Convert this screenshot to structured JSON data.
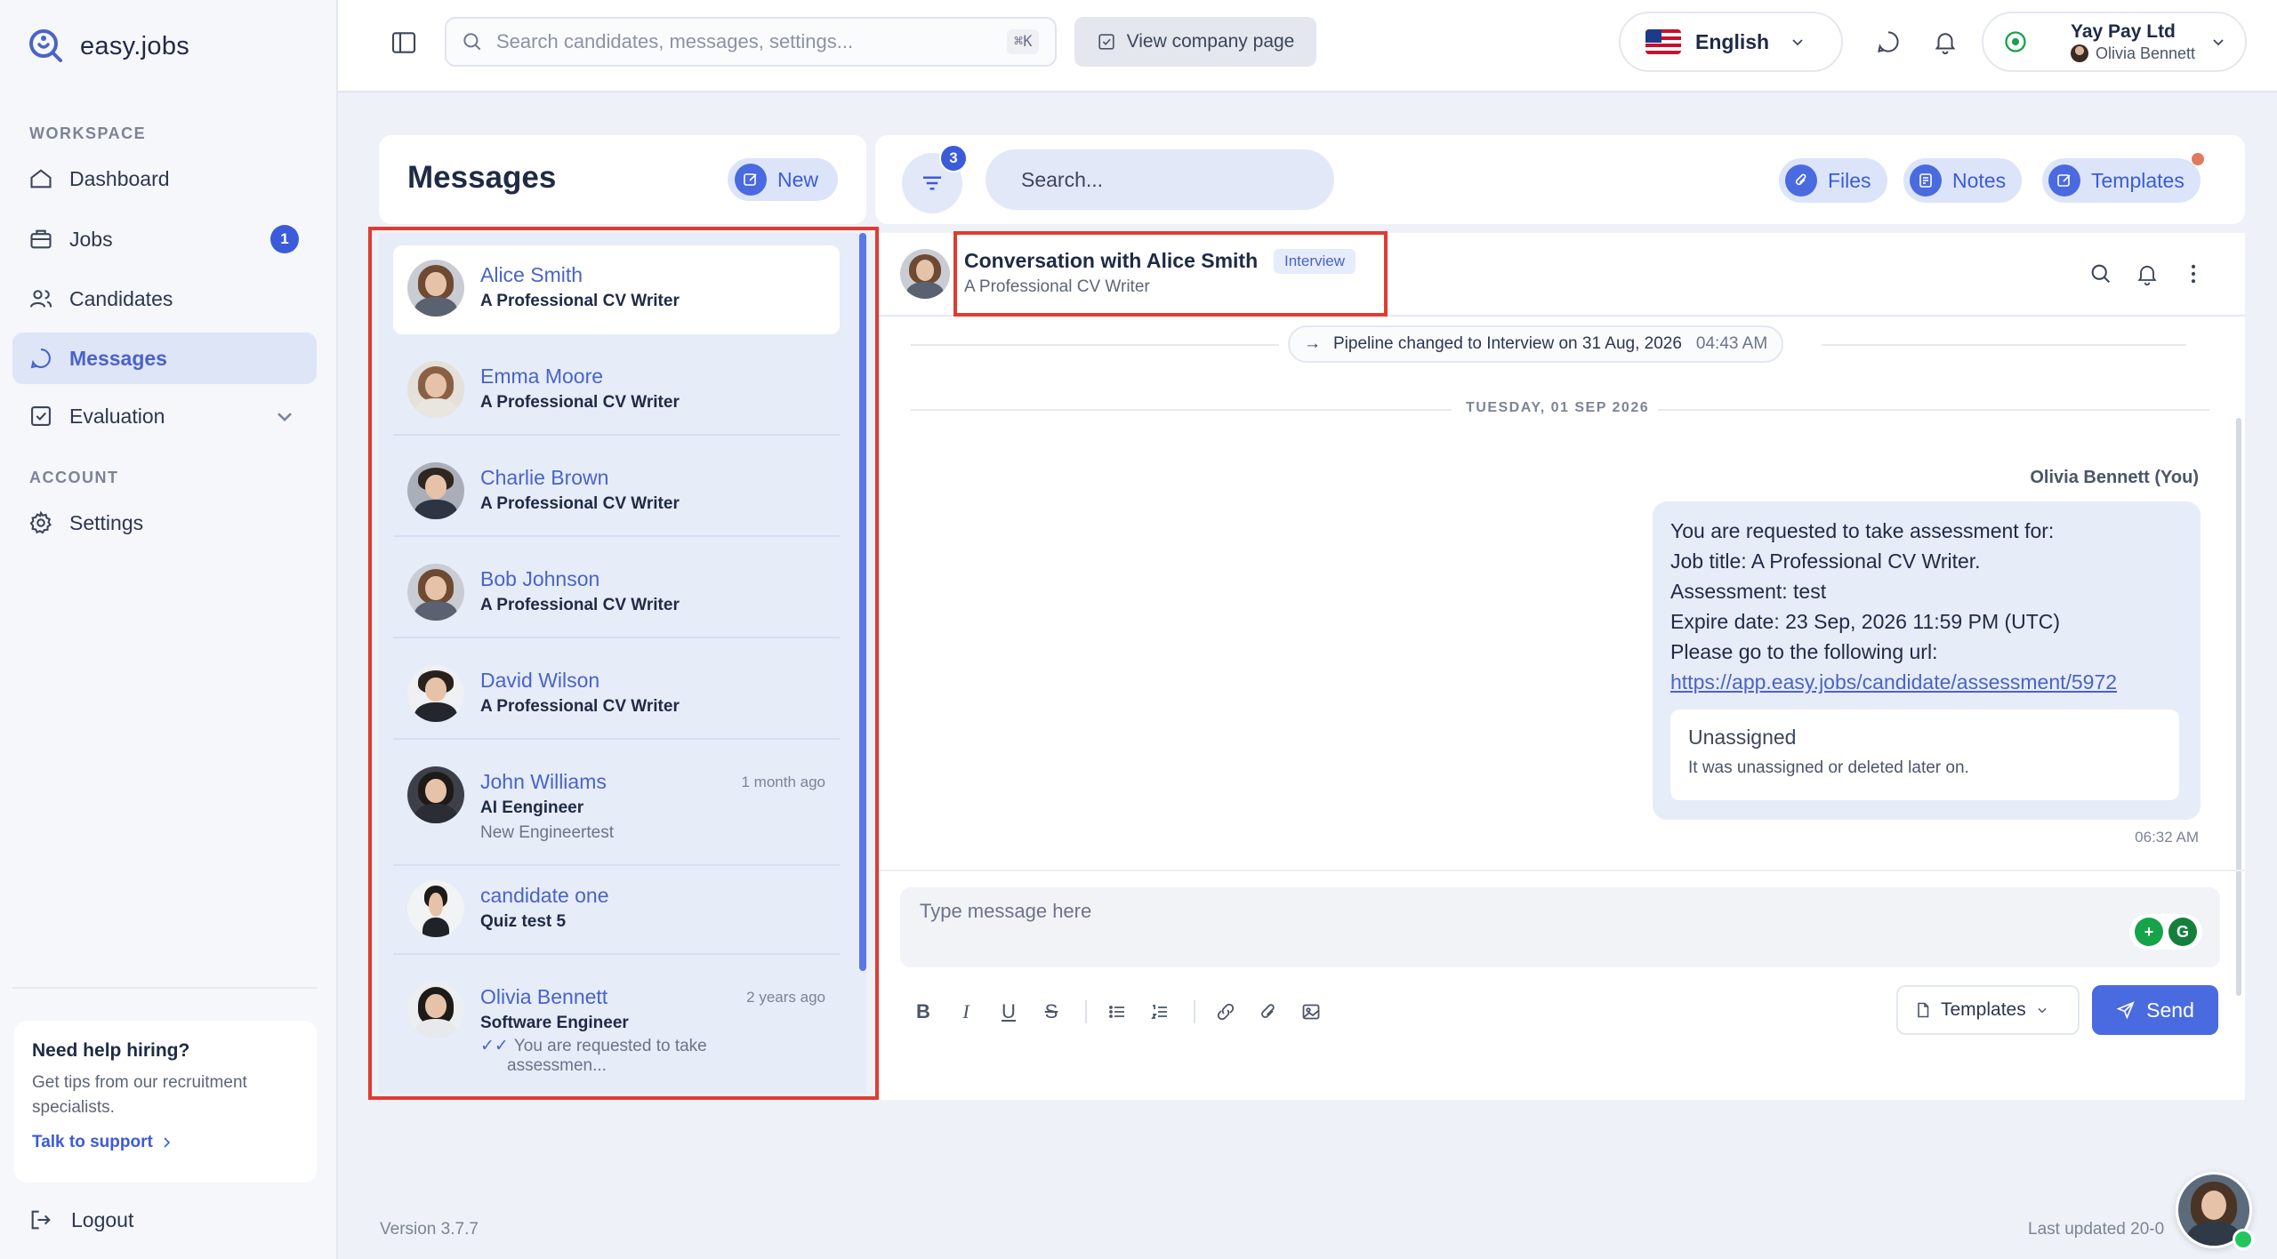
{
  "brand": {
    "name": "easy.jobs"
  },
  "sidebar": {
    "workspace_label": "WORKSPACE",
    "account_label": "ACCOUNT",
    "items": [
      {
        "label": "Dashboard",
        "icon": "home-icon"
      },
      {
        "label": "Jobs",
        "icon": "briefcase-icon",
        "badge": "1"
      },
      {
        "label": "Candidates",
        "icon": "users-icon"
      },
      {
        "label": "Messages",
        "icon": "chat-icon",
        "active": true
      },
      {
        "label": "Evaluation",
        "icon": "checklist-icon"
      }
    ],
    "settings_label": "Settings",
    "help": {
      "title": "Need help hiring?",
      "text": "Get tips from our recruitment specialists.",
      "link": "Talk to support"
    },
    "logout_label": "Logout"
  },
  "topbar": {
    "search_placeholder": "Search candidates, messages, settings...",
    "search_shortcut": "⌘K",
    "company_page_label": "View company page",
    "language": "English",
    "account": {
      "company": "Yay Pay Ltd",
      "user": "Olivia Bennett"
    }
  },
  "messages": {
    "title": "Messages",
    "new_label": "New",
    "filter_count": "3",
    "search_placeholder": "Search...",
    "files_label": "Files",
    "notes_label": "Notes",
    "templates_label": "Templates",
    "list": [
      {
        "name": "Alice Smith",
        "job": "A Professional CV Writer",
        "time": "",
        "sub": ""
      },
      {
        "name": "Emma Moore",
        "job": "A Professional CV Writer",
        "time": "",
        "sub": ""
      },
      {
        "name": "Charlie Brown",
        "job": "A Professional CV Writer",
        "time": "",
        "sub": ""
      },
      {
        "name": "Bob Johnson",
        "job": "A Professional CV Writer",
        "time": "",
        "sub": ""
      },
      {
        "name": "David Wilson",
        "job": "A Professional CV Writer",
        "time": "",
        "sub": ""
      },
      {
        "name": "John Williams",
        "job": "AI Eengineer",
        "time": "1 month ago",
        "sub": "New Engineertest"
      },
      {
        "name": "candidate one",
        "job": "Quiz test 5",
        "time": "",
        "sub": ""
      },
      {
        "name": "Olivia Bennett",
        "job": "Software Engineer",
        "time": "2 years ago",
        "preview_1": "You are requested to take",
        "preview_2": "assessmen..."
      }
    ]
  },
  "conversation": {
    "title": "Conversation with Alice Smith",
    "tag": "Interview",
    "subtitle": "A Professional CV Writer",
    "pipeline_note": "Pipeline changed to Interview on 31 Aug, 2026",
    "pipeline_time": "04:43 AM",
    "day_separator": "TUESDAY, 01 SEP 2026",
    "sender": "Olivia Bennett (You)",
    "message_lines": [
      "You are requested to take assessment for:",
      "Job title: A Professional CV Writer.",
      "Assessment: test",
      "Expire date: 23 Sep, 2026 11:59 PM (UTC)",
      "Please go to the following url:"
    ],
    "message_link": "https://app.easy.jobs/candidate/assessment/5972",
    "unassigned_title": "Unassigned",
    "unassigned_text": "It was unassigned or deleted later on.",
    "message_time": "06:32 AM",
    "composer_placeholder": "Type message here",
    "templates_label": "Templates",
    "send_label": "Send"
  },
  "footer": {
    "version": "Version 3.7.7",
    "last_updated": "Last updated 20-0"
  },
  "colors": {
    "accent": "#4a6ae0",
    "highlight": "#e03b32",
    "active_bg": "#dde5f7"
  }
}
